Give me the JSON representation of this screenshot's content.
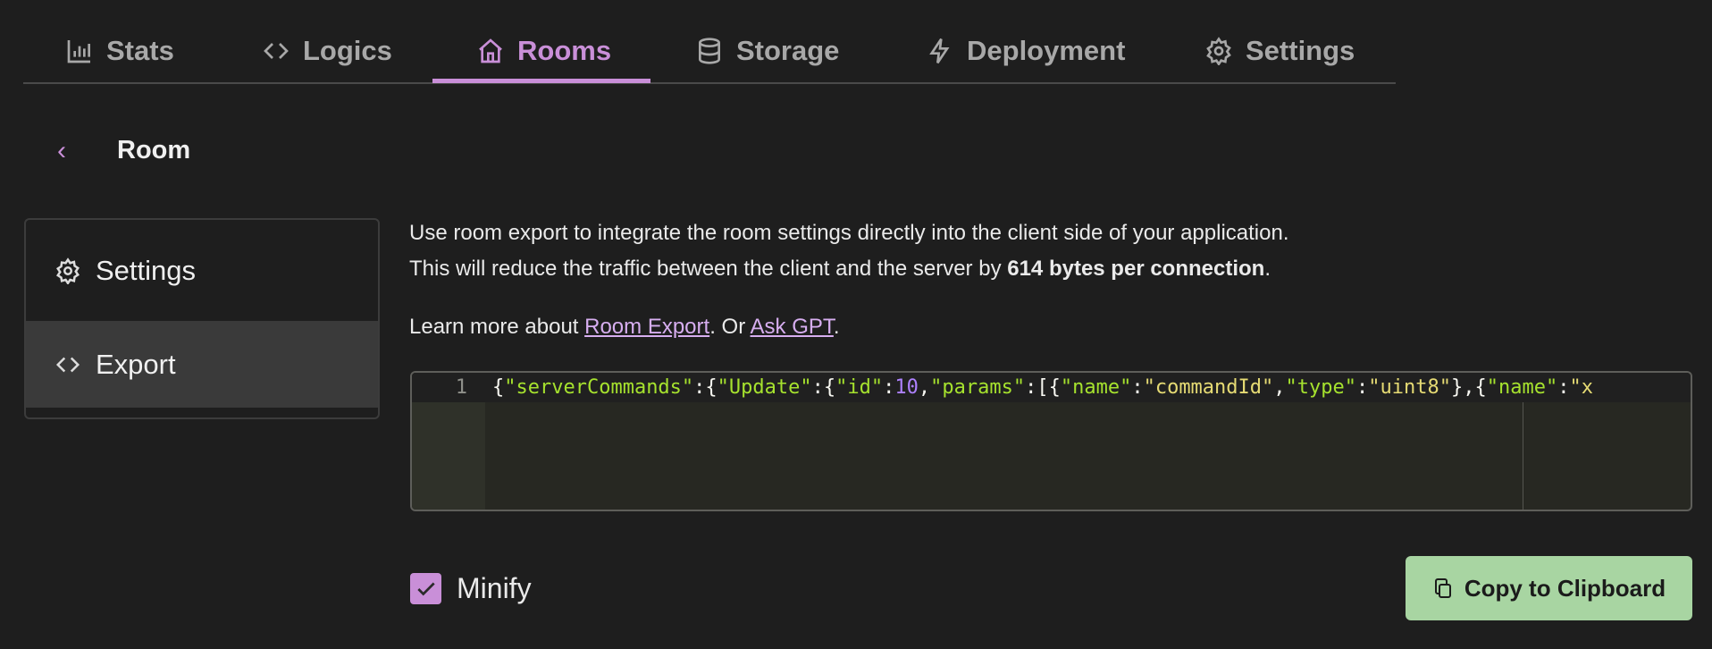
{
  "tabs": [
    {
      "label": "Stats",
      "icon": "bar-chart-icon"
    },
    {
      "label": "Logics",
      "icon": "code-icon"
    },
    {
      "label": "Rooms",
      "icon": "home-icon",
      "active": true
    },
    {
      "label": "Storage",
      "icon": "database-icon"
    },
    {
      "label": "Deployment",
      "icon": "lightning-icon"
    },
    {
      "label": "Settings",
      "icon": "gear-icon"
    }
  ],
  "page": {
    "back_icon": "chevron-left-icon",
    "title": "Room"
  },
  "side_menu": [
    {
      "label": "Settings",
      "icon": "gear-icon"
    },
    {
      "label": "Export",
      "icon": "code-icon",
      "selected": true
    }
  ],
  "description": {
    "line1": "Use room export to integrate the room settings directly into the client side of your application.",
    "line2_pre": "This will reduce the traffic between the client and the server by ",
    "line2_bold": "614 bytes per connection",
    "line2_post": ".",
    "learn_pre": "Learn more about ",
    "link1": "Room Export",
    "learn_mid": ". Or ",
    "link2": "Ask GPT",
    "learn_post": "."
  },
  "editor": {
    "line_number": "1",
    "code": "{\"serverCommands\":{\"Update\":{\"id\":10,\"params\":[{\"name\":\"commandId\",\"type\":\"uint8\"},{\"name\":\"x"
  },
  "minify": {
    "label": "Minify",
    "checked": true
  },
  "copy_button": {
    "label": "Copy to Clipboard",
    "icon": "clipboard-icon"
  },
  "colors": {
    "accent": "#c98fd8",
    "button": "#a8d5a2",
    "background": "#1e1e1e"
  }
}
